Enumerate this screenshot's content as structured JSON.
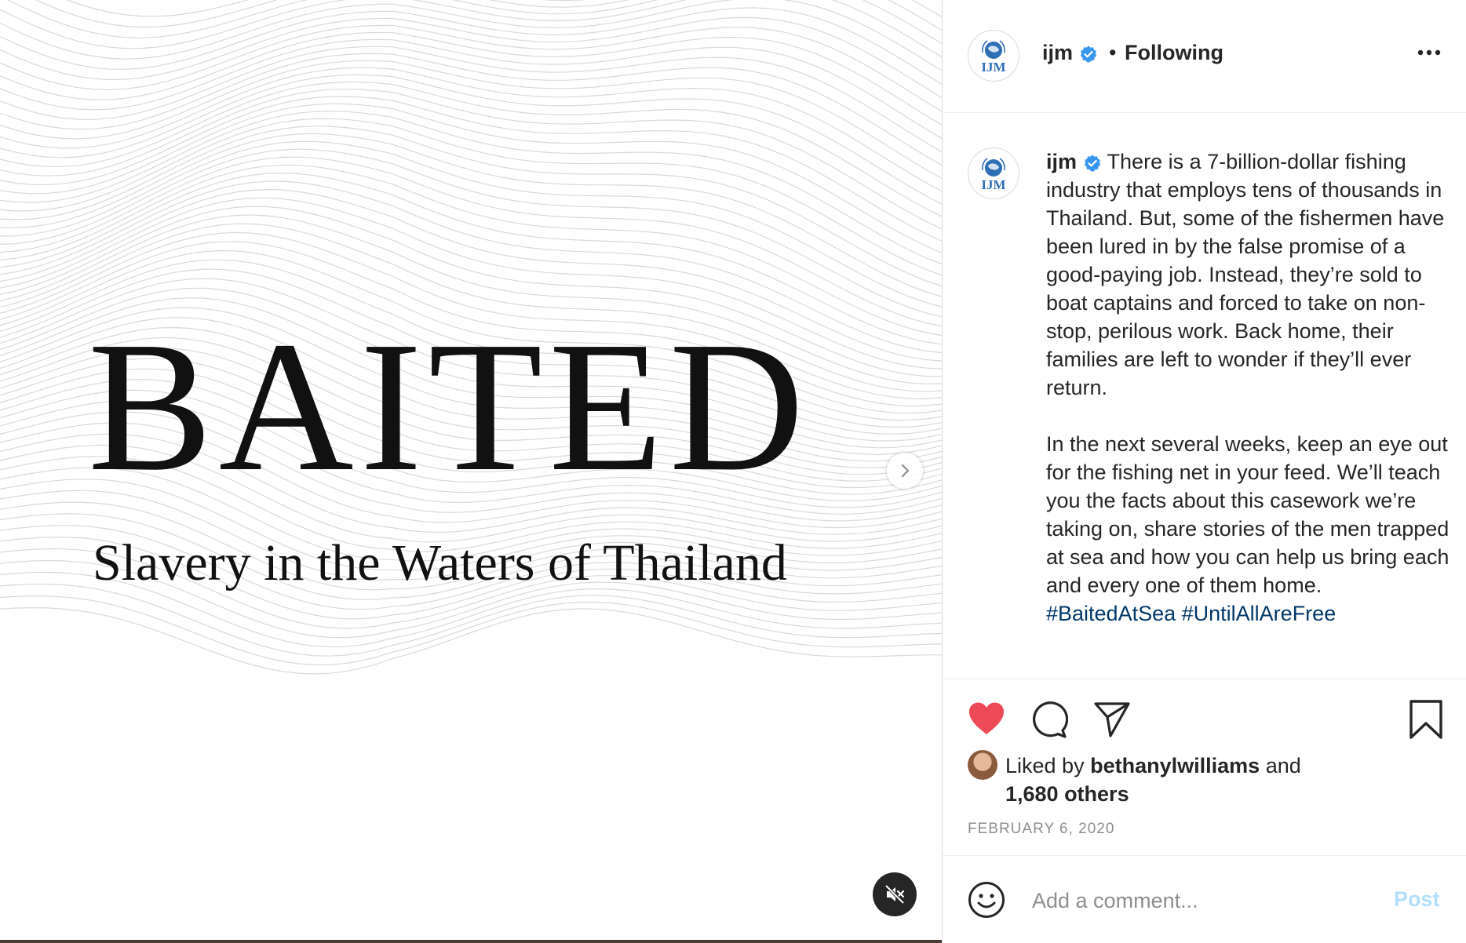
{
  "media": {
    "title": "BAITED",
    "subtitle": "Slavery in the Waters of Thailand"
  },
  "account": {
    "username": "ijm",
    "avatar_text": "IJM",
    "verified": true,
    "separator": "•",
    "follow_state": "Following"
  },
  "caption": {
    "username": "ijm",
    "paragraph1": "There is a 7-billion-dollar fishing industry that employs tens of thousands in Thailand. But, some of the fishermen have been lured in by the false promise of a good-paying job. Instead, they’re sold to boat captains and forced to take on non-stop, perilous work. Back home, their families are left to wonder if they’ll ever return.",
    "paragraph2": "In the next several weeks, keep an eye out for the fishing net in your feed. We’ll teach you the facts about this casework we’re taking on, share stories of the men trapped at sea and how you can help us bring each and every one of them home.",
    "hashtags": [
      "#BaitedAtSea",
      "#UntilAllAreFree"
    ]
  },
  "likes": {
    "prefix": "Liked by",
    "liker": "bethanylwilliams",
    "conjunction": "and",
    "others": "1,680 others",
    "liked_by_viewer": true
  },
  "date": "FEBRUARY 6, 2020",
  "comment": {
    "placeholder": "Add a comment...",
    "post_label": "Post"
  },
  "colors": {
    "like_red": "#ed4956",
    "verified_blue": "#3897f0",
    "hashtag_blue": "#00376b",
    "post_disabled": "#b2dffc"
  },
  "icons": [
    "globe-logo-icon",
    "verified-badge-icon",
    "more-options-icon",
    "heart-icon",
    "comment-icon",
    "share-icon",
    "bookmark-icon",
    "chevron-right-icon",
    "muted-speaker-icon",
    "emoji-icon"
  ]
}
